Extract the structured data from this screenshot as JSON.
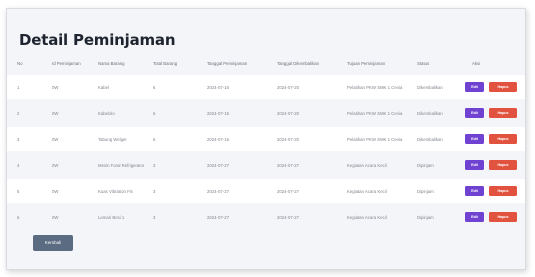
{
  "page": {
    "title": "Detail Peminjaman"
  },
  "table": {
    "headers": [
      "No",
      "Id Peminjaman",
      "Nama Barang",
      "Total Barang",
      "Tanggal Peminjaman",
      "Tanggal Dikembalikan",
      "Tujuan Peminjaman",
      "Status",
      "Aksi"
    ],
    "rows": [
      {
        "no": "1",
        "id": "0W",
        "nama": "Kabel",
        "total": "6",
        "tgl_pinjam": "2024-07-16",
        "tgl_kembali": "2024-07-20",
        "tujuan": "Pelatihan PKW SMK 1 Cenia",
        "status": "Dikembalikan"
      },
      {
        "no": "2",
        "id": "0W",
        "nama": "Kabelolo",
        "total": "6",
        "tgl_pinjam": "2024-07-16",
        "tgl_kembali": "2024-07-20",
        "tujuan": "Pelatihan PKW SMK 1 Cenia",
        "status": "Dikembalikan"
      },
      {
        "no": "3",
        "id": "0W",
        "nama": "Tabung Welger",
        "total": "6",
        "tgl_pinjam": "2024-07-16",
        "tgl_kembali": "2024-07-20",
        "tujuan": "Pelatihan PKW SMK 1 Cenia",
        "status": "Dikembalikan"
      },
      {
        "no": "4",
        "id": "0W",
        "nama": "Mesin Foral Refrigerator",
        "total": "3",
        "tgl_pinjam": "2024-07-27",
        "tgl_kembali": "2024-07-27",
        "tujuan": "Kegiatan Acara Kecil",
        "status": "Dipinjam"
      },
      {
        "no": "5",
        "id": "0W",
        "nama": "Kuas Vibration Fis",
        "total": "3",
        "tgl_pinjam": "2024-07-27",
        "tgl_kembali": "2024-07-27",
        "tujuan": "Kegiatan Acara Kecil",
        "status": "Dipinjam"
      },
      {
        "no": "6",
        "id": "0W",
        "nama": "Lemari Besi 1",
        "total": "3",
        "tgl_pinjam": "2024-07-27",
        "tgl_kembali": "2024-07-27",
        "tujuan": "Kegiatan Acara Kecil",
        "status": "Dipinjam"
      }
    ],
    "edit_label": "Edit",
    "hapus_label": "Hapus"
  },
  "footer": {
    "back_label": "Kembali"
  },
  "colors": {
    "edit": "#6f42d1",
    "hapus": "#e2533f",
    "back": "#5a6b82"
  }
}
